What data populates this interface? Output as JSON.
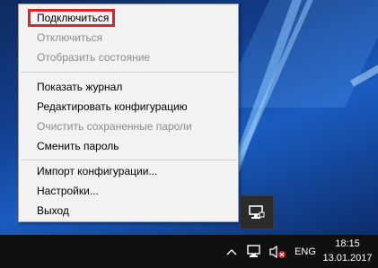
{
  "menu": {
    "items": [
      {
        "label": "Подключиться",
        "enabled": true
      },
      {
        "label": "Отключиться",
        "enabled": false
      },
      {
        "label": "Отобразить состояние",
        "enabled": false
      },
      {
        "label": "Показать журнал",
        "enabled": true
      },
      {
        "label": "Редактировать конфигурацию",
        "enabled": true
      },
      {
        "label": "Очистить сохраненные пароли",
        "enabled": false
      },
      {
        "label": "Сменить пароль",
        "enabled": true
      },
      {
        "label": "Импорт конфигурации...",
        "enabled": true
      },
      {
        "label": "Настройки...",
        "enabled": true
      },
      {
        "label": "Выход",
        "enabled": true
      }
    ],
    "highlight_color": "#e0202a"
  },
  "taskbar": {
    "language": "ENG",
    "time": "18:15",
    "date": "13.01.2017",
    "icons": [
      "chevron-up-icon",
      "network-icon",
      "volume-muted-icon"
    ]
  },
  "tray_popup": {
    "icon": "openvpn-monitor-icon"
  }
}
